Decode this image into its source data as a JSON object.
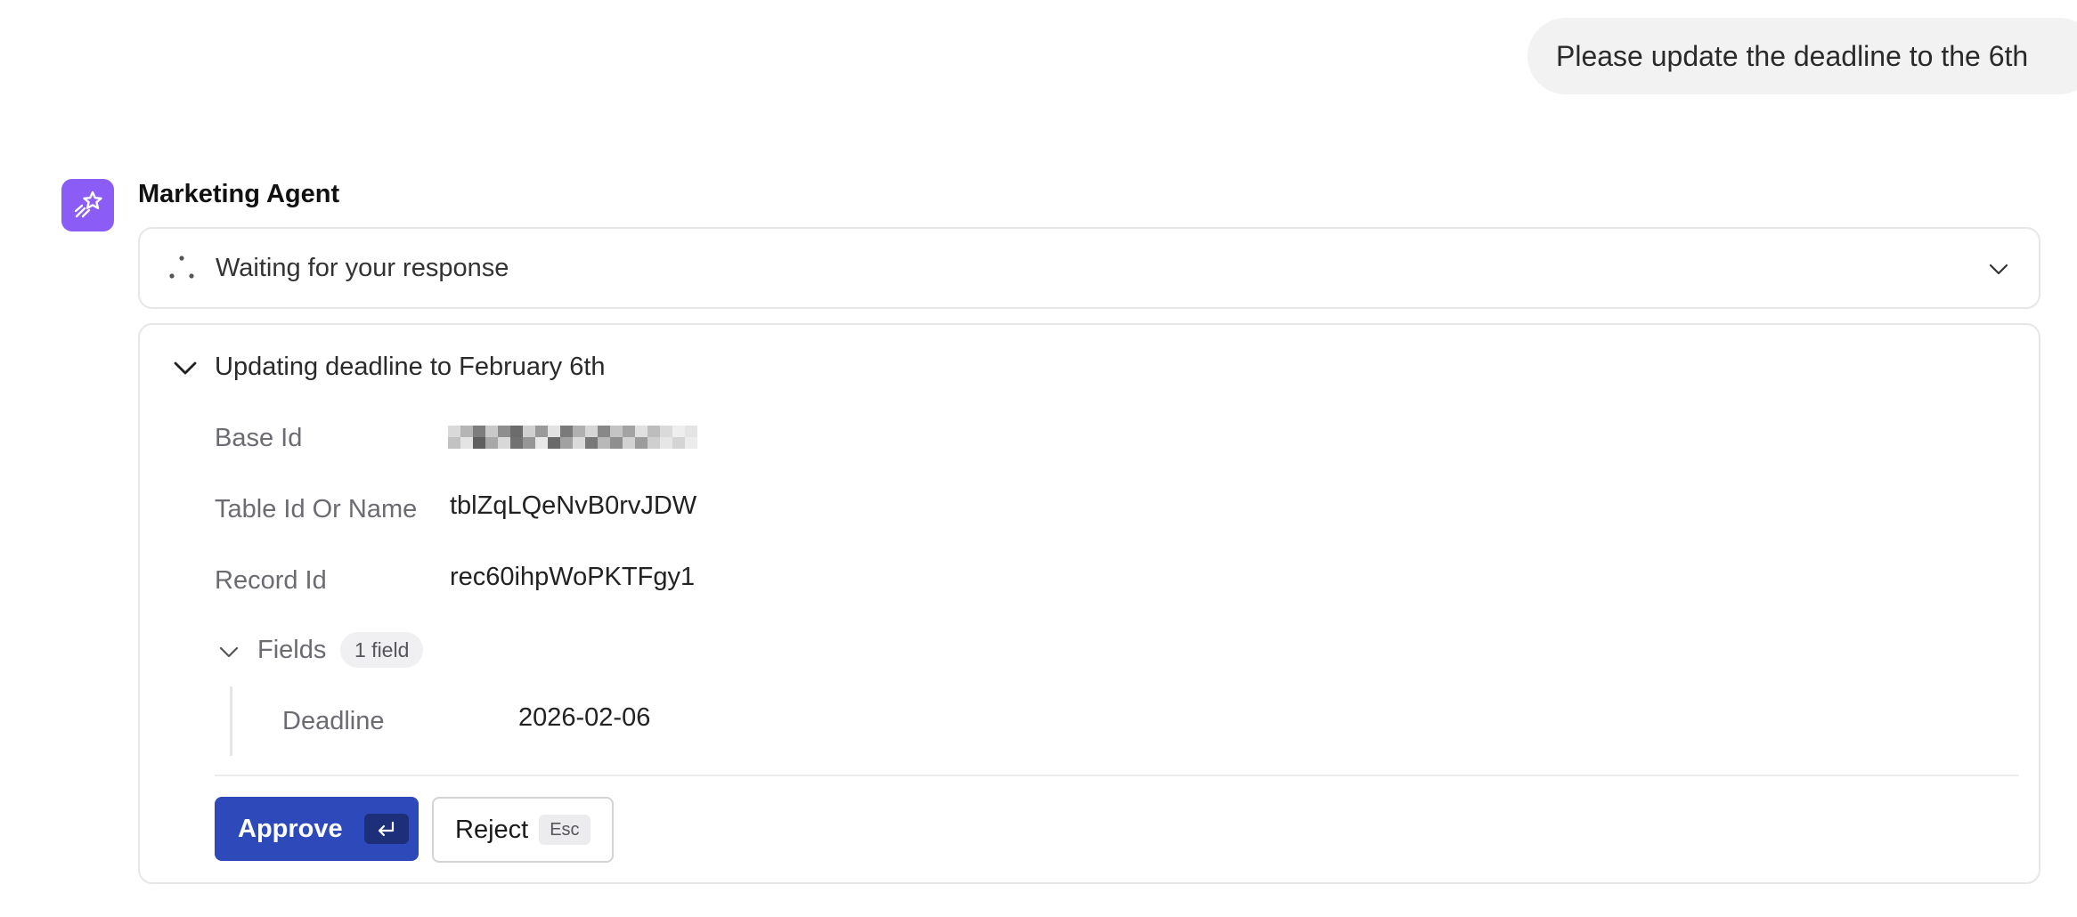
{
  "user_message": "Please update the deadline to the 6th",
  "agent": {
    "name": "Marketing Agent",
    "avatar_icon": "sparkle-wand-icon",
    "avatar_color": "#8b5cf6"
  },
  "status": {
    "text": "Waiting for your response",
    "icon": "loading-dots-icon"
  },
  "tool_call": {
    "title": "Updating deadline to February 6th",
    "params": [
      {
        "label": "Base Id",
        "value": ""
      },
      {
        "label": "Table Id Or Name",
        "value": "tblZqLQeNvB0rvJDW"
      },
      {
        "label": "Record Id",
        "value": "rec60ihpWoPKTFgy1"
      }
    ],
    "fields": {
      "label": "Fields",
      "badge": "1 field",
      "items": [
        {
          "label": "Deadline",
          "value": "2026-02-06"
        }
      ]
    }
  },
  "actions": {
    "approve_label": "Approve",
    "approve_key_icon": "enter-key-icon",
    "reject_label": "Reject",
    "reject_key": "Esc"
  },
  "colors": {
    "approve": "#2e4aba",
    "agent_accent": "#8b5cf6"
  }
}
